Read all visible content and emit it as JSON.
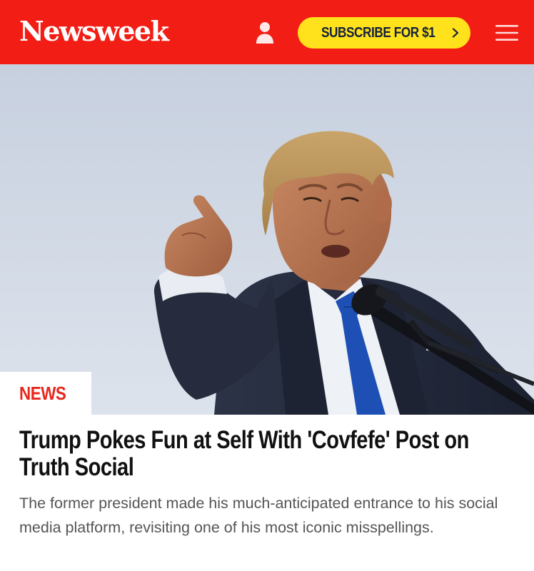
{
  "header": {
    "logo_text": "Newsweek",
    "subscribe_label": "SUBSCRIBE FOR $1",
    "account_icon": "person-icon",
    "subscribe_icon": "chevron-right-icon",
    "menu_icon": "hamburger-menu-icon",
    "colors": {
      "brand_red": "#f21d14",
      "subscribe_yellow": "#ffe21c",
      "subscribe_text": "#14213d"
    }
  },
  "article": {
    "category": "NEWS",
    "headline": "Trump Pokes Fun at Self With 'Covfefe' Post on Truth Social",
    "dek": "The former president made his much-anticipated entrance to his social media platform, revisiting one of his most iconic misspellings.",
    "category_color": "#e8271c"
  }
}
